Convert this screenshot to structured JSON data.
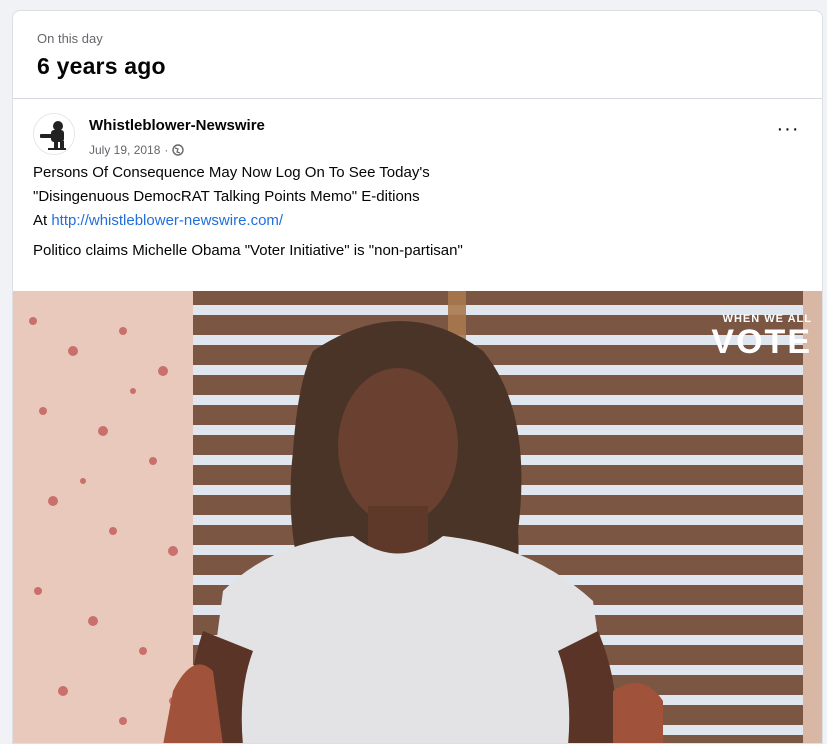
{
  "memory": {
    "eyebrow": "On this day",
    "title": "6 years ago"
  },
  "post": {
    "author": "Whistleblower-Newswire",
    "date": "July 19, 2018",
    "separator": "·",
    "privacy_icon": "globe-icon",
    "more_label": "···",
    "text_line1": "Persons Of Consequence May Now Log On To See Today's",
    "text_line2": "\"Disingenuous DemocRAT Talking Points Memo\" E-ditions",
    "text_line3_prefix": "At ",
    "link": "http://whistleblower-newswire.com/",
    "text_second": "Politico claims Michelle Obama \"Voter Initiative\" is \"non-partisan\""
  },
  "media": {
    "watermark_small": "WHEN WE ALL",
    "watermark_big": "VOTE"
  },
  "colors": {
    "link": "#216fdb",
    "secondary_text": "#65676b",
    "page_background": "#f0f2f5"
  }
}
